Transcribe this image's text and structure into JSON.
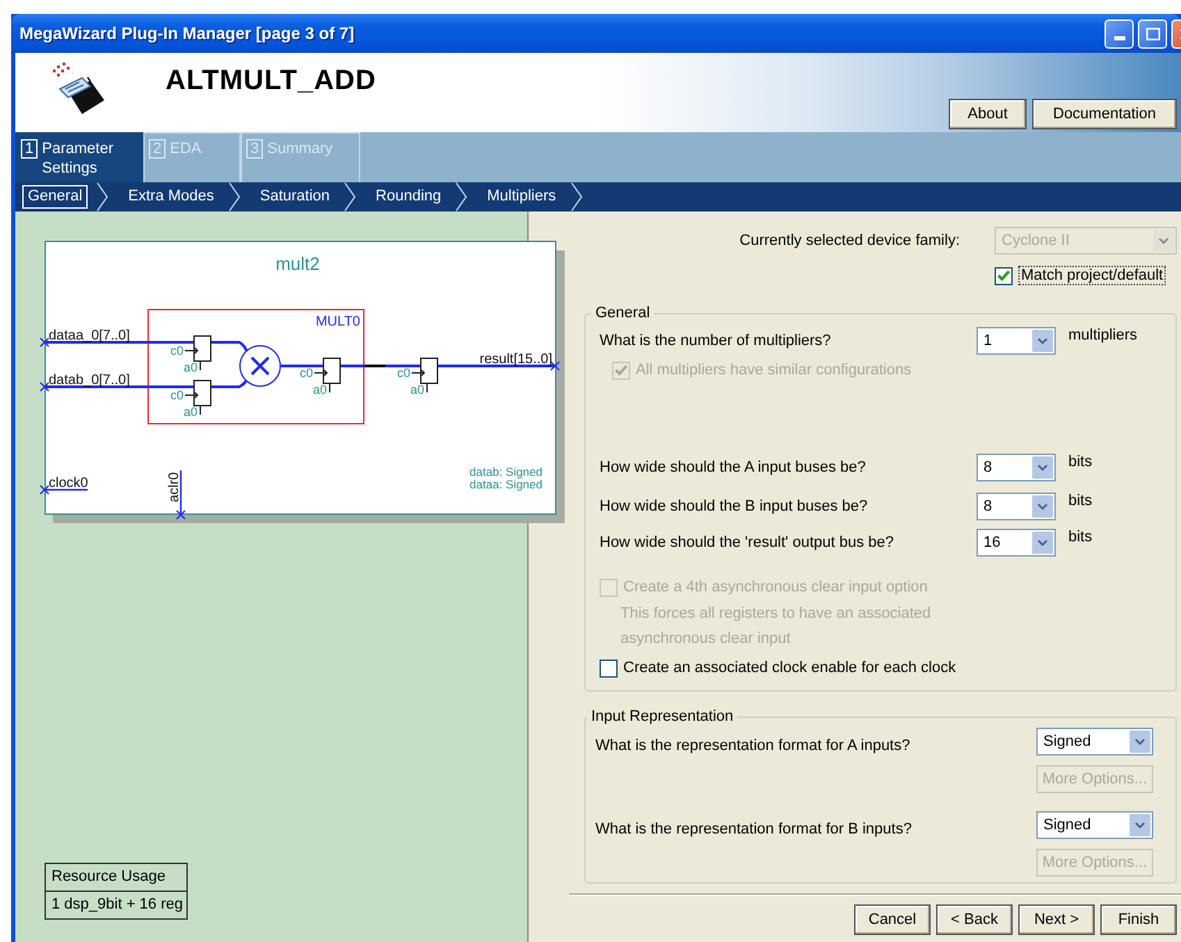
{
  "window": {
    "title": "MegaWizard Plug-In Manager [page 3 of 7]"
  },
  "header": {
    "component": "ALTMULT_ADD",
    "buttons": [
      "About",
      "Documentation"
    ]
  },
  "steps": [
    {
      "number": "1",
      "label": "Parameter Settings",
      "selected": true
    },
    {
      "number": "2",
      "label": "EDA",
      "selected": false
    },
    {
      "number": "3",
      "label": "Summary",
      "selected": false
    }
  ],
  "subtabs": [
    {
      "label": "General",
      "selected": true
    },
    {
      "label": "Extra Modes",
      "selected": false
    },
    {
      "label": "Saturation",
      "selected": false
    },
    {
      "label": "Rounding",
      "selected": false
    },
    {
      "label": "Multipliers",
      "selected": false
    }
  ],
  "diagram": {
    "title": "mult2",
    "block": "MULT0",
    "inputs": [
      "dataa_0[7..0]",
      "datab_0[7..0]"
    ],
    "output": "result[15..0]",
    "clock": "clock0",
    "aclr": "aclr0",
    "registers": [
      {
        "clock": "c0",
        "clear": "a0"
      },
      {
        "clock": "c0",
        "clear": "a0"
      },
      {
        "clock": "c0",
        "clear": "a0"
      },
      {
        "clock": "c0",
        "clear": "a0"
      }
    ],
    "notes": [
      "datab: Signed",
      "dataa: Signed"
    ]
  },
  "resource_usage": {
    "title": "Resource Usage",
    "value": "1 dsp_9bit + 16 reg"
  },
  "device": {
    "label": "Currently selected device family:",
    "value": "Cyclone II",
    "disabled": true
  },
  "match": {
    "label": "Match project/default",
    "checked": true
  },
  "general": {
    "legend": "General",
    "multipliers": {
      "question": "What is the number of multipliers?",
      "value": "1",
      "unit": "multipliers"
    },
    "similar": {
      "label": "All multipliers have similar configurations",
      "checked": true,
      "disabled": true
    },
    "widths": [
      {
        "question": "How wide should the A input buses be?",
        "value": "8",
        "unit": "bits"
      },
      {
        "question": "How wide should the B input buses be?",
        "value": "8",
        "unit": "bits"
      },
      {
        "question": "How wide should the 'result' output bus be?",
        "value": "16",
        "unit": "bits"
      }
    ],
    "aclr4": {
      "label": "Create a 4th asynchronous clear input option",
      "note": "This forces all registers to have an associated asynchronous clear input",
      "checked": false,
      "disabled": true
    },
    "clock_enable": {
      "label": "Create an associated clock enable for each clock",
      "checked": false,
      "disabled": false
    }
  },
  "input_representation": {
    "legend": "Input Representation",
    "rows": [
      {
        "question": "What is the representation format for A inputs?",
        "value": "Signed",
        "more": "More Options...",
        "more_disabled": true
      },
      {
        "question": "What is the representation format for B inputs?",
        "value": "Signed",
        "more": "More Options...",
        "more_disabled": true
      }
    ]
  },
  "footer": [
    {
      "label": "Cancel"
    },
    {
      "label": "< Back"
    },
    {
      "label": "Next >"
    },
    {
      "label": "Finish"
    }
  ]
}
